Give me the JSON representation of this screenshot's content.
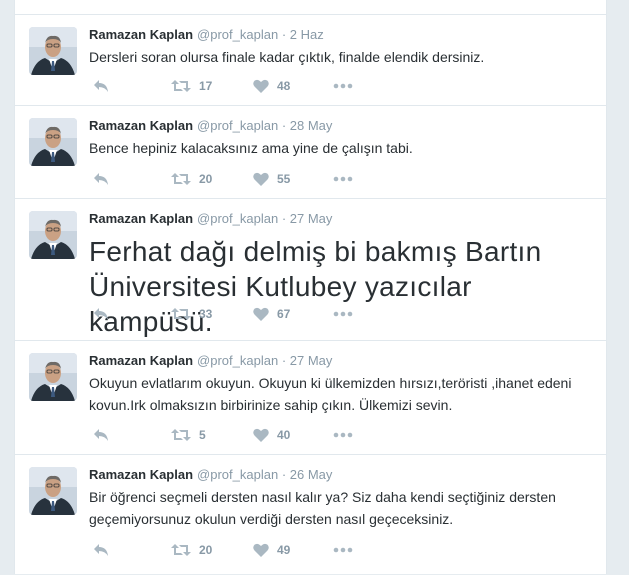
{
  "tweets": [
    {
      "name": "Ramazan Kaplan",
      "handle": "@prof_kaplan",
      "sep": "·",
      "date": "2 Haz",
      "text": "Dersleri soran olursa finale kadar çıktık, finalde elendik dersiniz.",
      "retweets": "17",
      "likes": "48"
    },
    {
      "name": "Ramazan Kaplan",
      "handle": "@prof_kaplan",
      "sep": "·",
      "date": "28 May",
      "text": "Bence hepiniz kalacaksınız ama yine de çalışın tabi.",
      "retweets": "20",
      "likes": "55"
    },
    {
      "name": "Ramazan Kaplan",
      "handle": "@prof_kaplan",
      "sep": "·",
      "date": "27 May",
      "text": "Ferhat dağı delmiş bi bakmış Bartın Üniversitesi Kutlubey yazıcılar kampüsü.",
      "retweets": "33",
      "likes": "67"
    },
    {
      "name": "Ramazan Kaplan",
      "handle": "@prof_kaplan",
      "sep": "·",
      "date": "27 May",
      "text": "Okuyun evlatlarım okuyun. Okuyun ki ülkemizden hırsızı,teröristi ,ihanet edeni kovun.Irk olmaksızın birbirinize sahip çıkın. Ülkemizi sevin.",
      "retweets": "5",
      "likes": "40"
    },
    {
      "name": "Ramazan Kaplan",
      "handle": "@prof_kaplan",
      "sep": "·",
      "date": "26 May",
      "text": "Bir öğrenci seçmeli dersten nasıl kalır ya? Siz daha kendi seçtiğiniz dersten geçemiyorsunuz okulun verdiği dersten nasıl geçeceksiniz.",
      "retweets": "20",
      "likes": "49"
    }
  ],
  "icons": {
    "reply": "reply-icon",
    "retweet": "retweet-icon",
    "like": "heart-icon",
    "more": "more-icon"
  },
  "colors": {
    "name": "#292f33",
    "meta": "#8899a6",
    "icon": "#aab8c2",
    "border": "#e1e8ed",
    "background": "#e6ecf0"
  }
}
